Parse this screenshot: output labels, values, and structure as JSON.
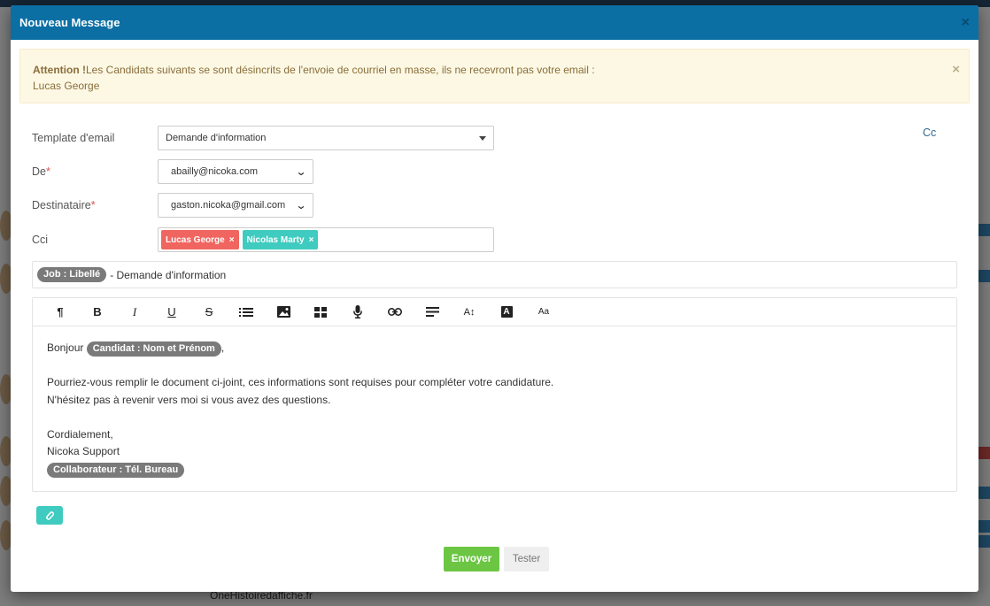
{
  "modal": {
    "title": "Nouveau Message",
    "close": "×"
  },
  "alert": {
    "strong": "Attention !",
    "message": "Les Candidats suivants se sont désincrits de l'envoie de courriel en masse, ils ne recevront pas votre email :",
    "names": "Lucas George",
    "close": "×"
  },
  "form": {
    "template_label": "Template d'email",
    "template_value": "Demande d'information",
    "from_label": "De",
    "from_value": "abailly@nicoka.com",
    "to_label": "Destinataire",
    "to_value": "gaston.nicoka@gmail.com",
    "bcc_label": "Cci",
    "bcc_tags": [
      "Lucas George",
      "Nicolas Marty"
    ],
    "cc_link": "Cc",
    "required_mark": "*"
  },
  "subject": {
    "token": "Job : Libellé",
    "rest": "- Demande d'information"
  },
  "toolbar": {
    "icons": [
      "paragraph-icon",
      "bold-icon",
      "italic-icon",
      "underline-icon",
      "strikethrough-icon",
      "list-icon",
      "image-icon",
      "table-icon",
      "microphone-icon",
      "link-icon",
      "align-icon",
      "line-height-icon",
      "text-color-icon",
      "font-size-icon"
    ],
    "bold": "B",
    "italic": "I",
    "underline": "U",
    "strike": "S",
    "paragraph": "¶",
    "line_height": "A↕",
    "text_color": "A",
    "font_size": "Aa"
  },
  "body": {
    "greeting": "Bonjour",
    "greeting_token": "Candidat : Nom et Prénom",
    "greeting_end": ",",
    "line1": "Pourriez-vous remplir le document ci-joint, ces informations sont requises pour compléter votre candidature.",
    "line2": "N'hésitez pas à revenir vers moi si vous avez des questions.",
    "closing": "Cordialement,",
    "signature": "Nicoka Support",
    "signature_token": "Collaborateur : Tél. Bureau"
  },
  "actions": {
    "send": "Envoyer",
    "test": "Tester"
  },
  "background": {
    "footer_text": "OneHistoiredaffiche.fr"
  },
  "colors": {
    "header": "#0b6fa4",
    "send": "#6cc644",
    "chip_red": "#f0655f",
    "chip_teal": "#3fcbbf",
    "alert_bg": "#fcf8e3",
    "alert_text": "#8a6d3b"
  }
}
